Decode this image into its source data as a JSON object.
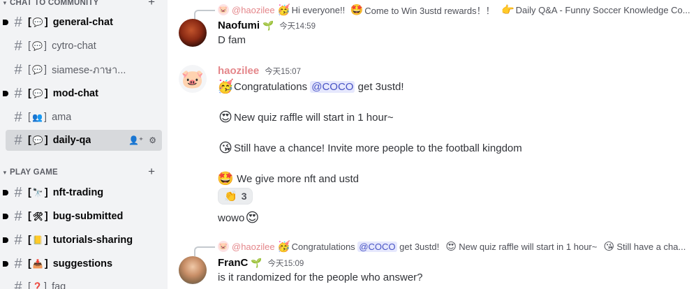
{
  "sidebar": {
    "category_community": {
      "label": "CHAT TO COMMUNITY"
    },
    "category_game": {
      "label": "PLAY GAME"
    },
    "channels": [
      {
        "label": "general-chat",
        "icon": "speech-bubble-icon",
        "emoji": "💬",
        "state": "unread"
      },
      {
        "label": "cytro-chat",
        "icon": "speech-bubble-icon",
        "emoji": "💬",
        "state": "read"
      },
      {
        "label": "siamese-ภาษา...",
        "icon": "speech-bubble-icon",
        "emoji": "💬",
        "state": "read"
      },
      {
        "label": "mod-chat",
        "icon": "speech-bubble-icon",
        "emoji": "💬",
        "state": "unread"
      },
      {
        "label": "ama",
        "icon": "people-icon",
        "emoji": "👥",
        "state": "read"
      },
      {
        "label": "daily-qa",
        "icon": "speech-bubble-icon",
        "emoji": "💬",
        "state": "selected"
      }
    ],
    "game_channels": [
      {
        "label": "nft-trading",
        "icon": "binoculars-icon",
        "emoji": "🔭",
        "state": "unread"
      },
      {
        "label": "bug-submitted",
        "icon": "tools-icon",
        "emoji": "🛠",
        "state": "unread"
      },
      {
        "label": "tutorials-sharing",
        "icon": "notebook-icon",
        "emoji": "📒",
        "state": "unread"
      },
      {
        "label": "suggestions",
        "icon": "inbox-icon",
        "emoji": "📥",
        "state": "unread"
      },
      {
        "label": "faq",
        "icon": "question-icon",
        "emoji": "❓",
        "state": "read"
      }
    ],
    "open_brackets": "[",
    "close_brackets": "]"
  },
  "messages": [
    {
      "reply": {
        "author": "@haozilee",
        "text1": "Hi everyone!!",
        "text2": "Come to Win 3ustd rewards！！",
        "text3": "Daily Q&A - Funny Soccer Knowledge Co..."
      },
      "author": "Naofumi",
      "time": "今天14:59",
      "lines": [
        "D fam"
      ]
    },
    {
      "author": "haozilee",
      "time": "今天15:07",
      "line1_pre": "Congratulations",
      "line1_mention": "@COCO",
      "line1_post": "get 3ustd!",
      "line2": "New quiz raffle will start in 1 hour~",
      "line3": "Still have a chance! Invite more people to the football kingdom",
      "line4": " We give more nft and ustd",
      "reaction_count": "3",
      "after_reaction": "wowo"
    },
    {
      "reply": {
        "author": "@haozilee",
        "text1": "Congratulations",
        "mention": "@COCO",
        "text2": "get 3ustd!",
        "text3": "New quiz raffle will start in 1 hour~",
        "text4": "Still have a cha..."
      },
      "author": "FranC",
      "time": "今天15:09",
      "lines": [
        "is it randomized for the people who answer?"
      ]
    }
  ],
  "colors": {
    "sidebar_bg": "#f2f3f5",
    "selected_bg": "#d7d9dc",
    "haozilee_name": "#e4868a",
    "mention_bg": "#e6e8fd",
    "mention_fg": "#4752c4"
  }
}
